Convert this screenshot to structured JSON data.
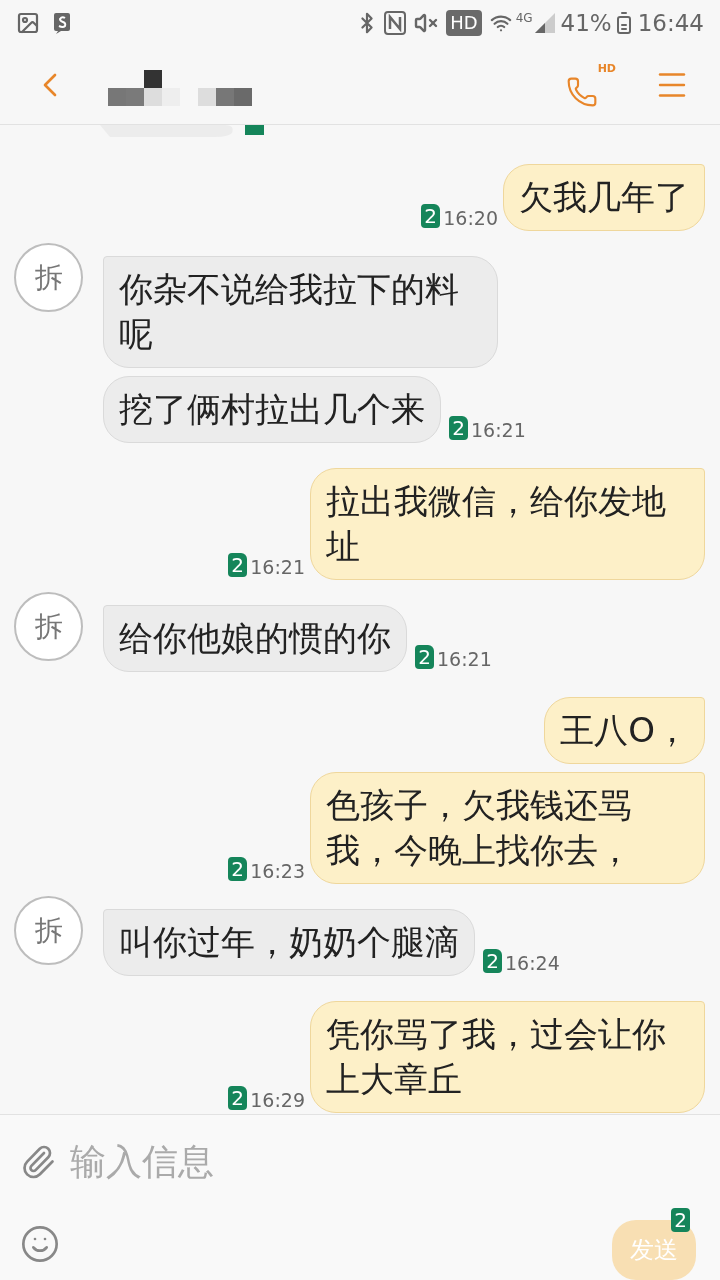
{
  "status_bar": {
    "hd_badge": "HD",
    "network": "4G",
    "battery": "41%",
    "time": "16:44"
  },
  "header": {
    "call_badge": "HD"
  },
  "messages": [
    {
      "kind": "sent",
      "text": "欠我几年了",
      "sim": "2",
      "time": "16:20"
    },
    {
      "kind": "received",
      "avatar": "拆",
      "text": "你杂不说给我拉下的料呢"
    },
    {
      "kind": "received",
      "text": "挖了俩村拉出几个来",
      "sim": "2",
      "time": "16:21"
    },
    {
      "kind": "sent",
      "text": "拉出我微信，给你发地址",
      "sim": "2",
      "time": "16:21"
    },
    {
      "kind": "received",
      "avatar": "拆",
      "text": "给你他娘的惯的你",
      "sim": "2",
      "time": "16:21"
    },
    {
      "kind": "sent",
      "text": "王八O，"
    },
    {
      "kind": "sent",
      "text": "色孩子，欠我钱还骂我，今晚上找你去，",
      "sim": "2",
      "time": "16:23"
    },
    {
      "kind": "received",
      "avatar": "拆",
      "text": "叫你过年，奶奶个腿滴",
      "sim": "2",
      "time": "16:24"
    },
    {
      "kind": "sent",
      "text": "凭你骂了我，过会让你上大章丘",
      "sim": "2",
      "time": "16:29"
    }
  ],
  "composer": {
    "placeholder": "输入信息",
    "send_label": "发送",
    "send_sim": "2"
  }
}
